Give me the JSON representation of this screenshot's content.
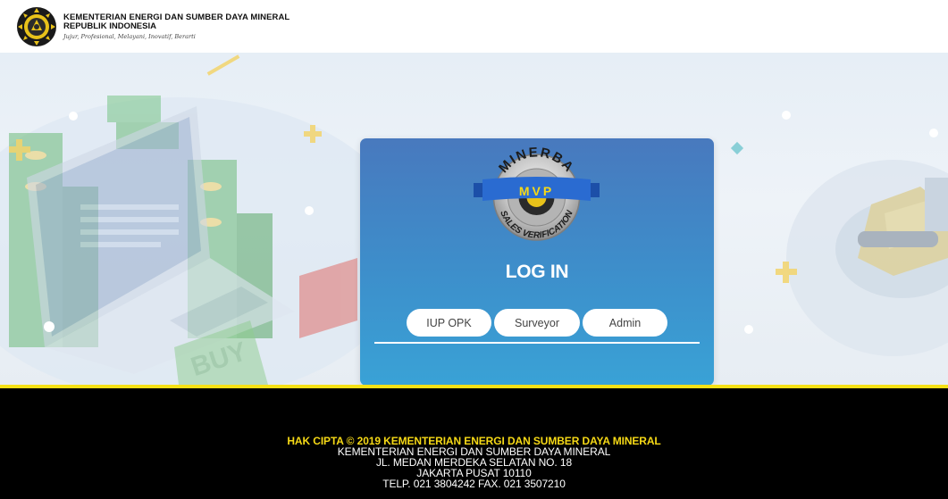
{
  "header": {
    "ministry_name": "KEMENTERIAN ENERGI DAN SUMBER DAYA MINERAL",
    "country_name": "REPUBLIK INDONESIA",
    "motto": "Jujur, Profesional, Melayani, Inovatif, Berarti"
  },
  "login": {
    "logo_top_text": "MINERBA",
    "logo_banner_text": "MVP",
    "logo_bottom_text": "SALES VERIFICATION",
    "title": "LOG IN",
    "tabs": [
      {
        "label": "IUP OPK"
      },
      {
        "label": "Surveyor"
      },
      {
        "label": "Admin"
      }
    ]
  },
  "footer": {
    "copyright": "HAK CIPTA © 2019 KEMENTERIAN ENERGI DAN SUMBER DAYA MINERAL",
    "lines": [
      "KEMENTERIAN ENERGI DAN SUMBER DAYA MINERAL",
      "JL. MEDAN MERDEKA SELATAN NO. 18",
      "JAKARTA PUSAT 10110",
      "TELP. 021 3804242 FAX. 021 3507210"
    ]
  },
  "colors": {
    "card_top": "#4879be",
    "card_bottom": "#39a2d6",
    "footer_bg": "#000000",
    "accent_yellow": "#f6e116",
    "copyright_yellow": "#f6d916"
  }
}
